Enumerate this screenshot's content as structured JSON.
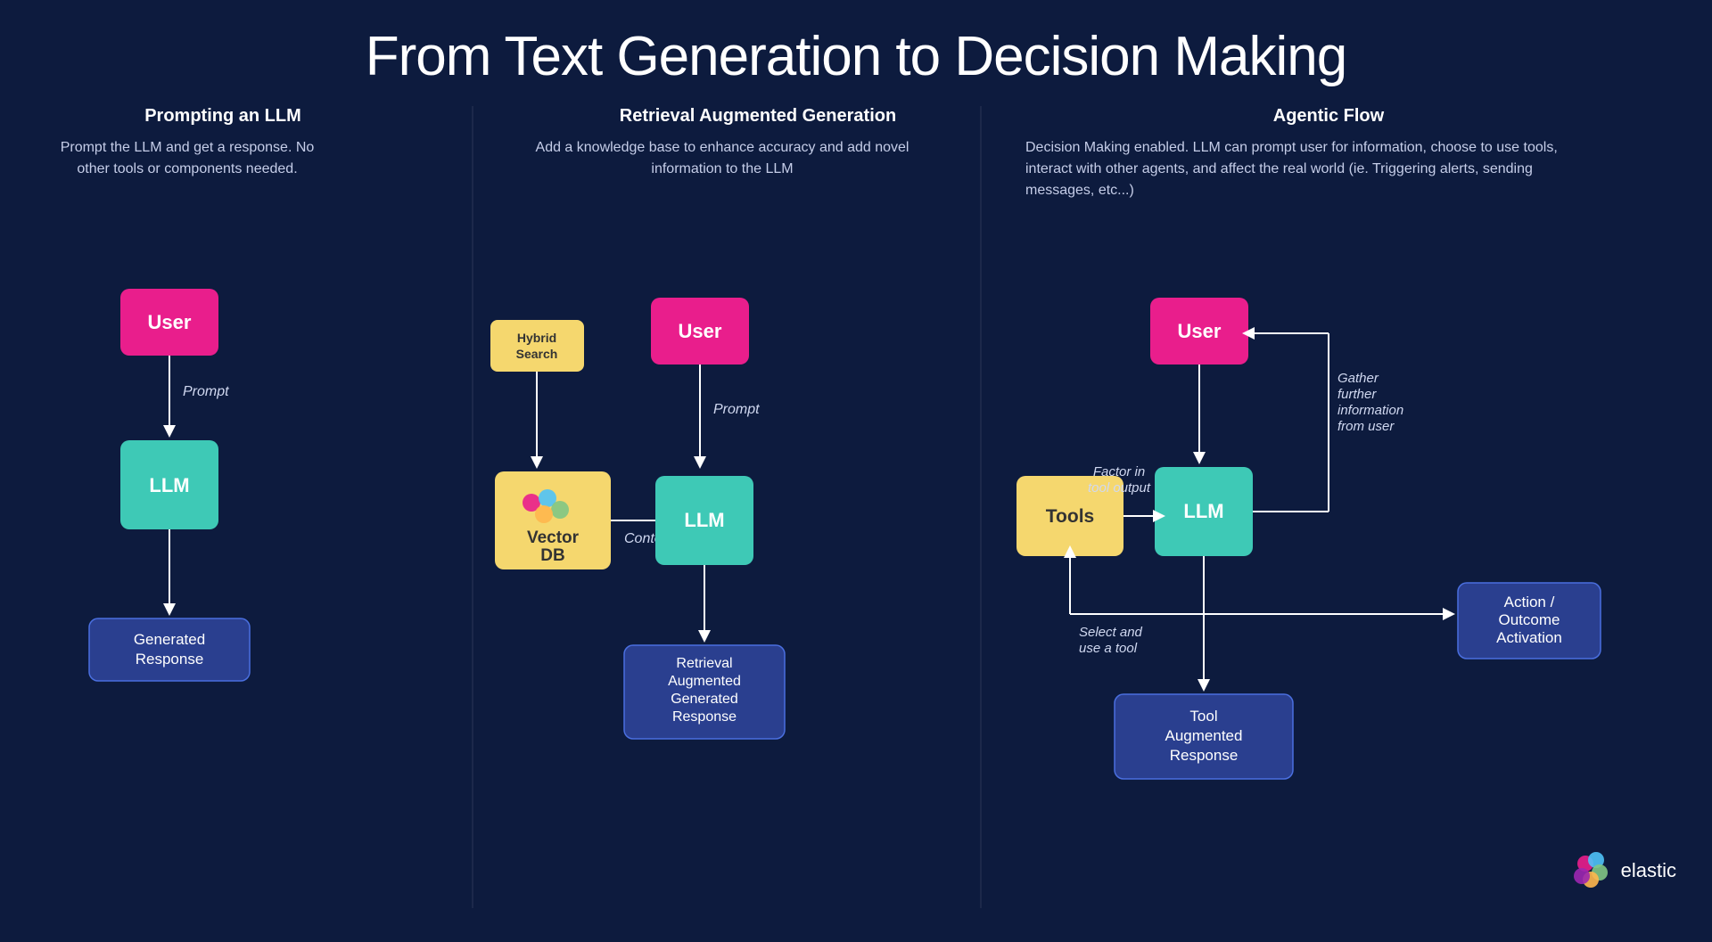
{
  "title": "From Text Generation to Decision Making",
  "columns": [
    {
      "id": "prompting",
      "title": "Prompting an LLM",
      "description": "Prompt the LLM and get a response. No other tools or components needed.",
      "nodes": {
        "user": "User",
        "prompt_label": "Prompt",
        "llm": "LLM",
        "response": "Generated\nResponse"
      }
    },
    {
      "id": "rag",
      "title": "Retrieval Augmented Generation",
      "description": "Add a knowledge base to enhance accuracy and add novel information to the LLM",
      "nodes": {
        "hybrid_search": "Hybrid\nSearch",
        "user": "User",
        "vectordb": "Vector\nDB",
        "llm": "LLM",
        "prompt_label": "Prompt",
        "context_label": "Context",
        "response": "Retrieval\nAugmented\nGenerated\nResponse"
      }
    },
    {
      "id": "agentic",
      "title": "Agentic Flow",
      "description": "Decision Making enabled. LLM can prompt user for information, choose to use tools, interact with other agents, and affect the real world (ie. Triggering alerts, sending messages, etc...)",
      "nodes": {
        "user": "User",
        "llm": "LLM",
        "tools": "Tools",
        "tool_response": "Tool\nAugmented\nResponse",
        "action": "Action /\nOutcome\nActivation",
        "gather_label": "Gather\nfurther\ninformation\nfrom user",
        "factor_label": "Factor in\ntool output",
        "select_label": "Select and\nuse a tool"
      }
    }
  ],
  "elastic_logo": "elastic",
  "colors": {
    "bg": "#0d1b3e",
    "user_box": "#e91e8c",
    "llm_box": "#3ec9b6",
    "yellow_box": "#f5d76e",
    "response_box": "#2a3f8f",
    "arrow": "#ffffff"
  }
}
